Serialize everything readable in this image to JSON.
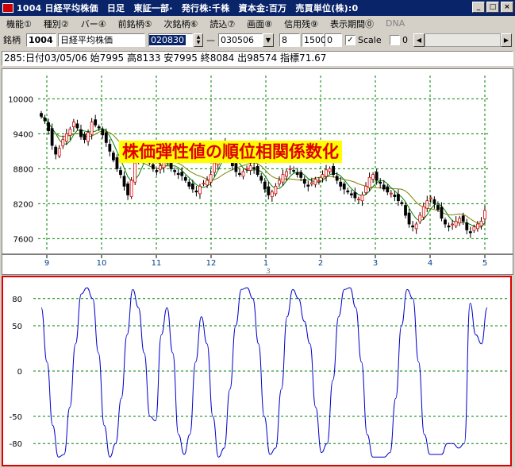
{
  "window": {
    "title": "1004 日経平均株価　日足　東証一部·　発行株:千株　資本金:百万　売買単位(株):0",
    "minimize_glyph": "_",
    "maximize_glyph": "□",
    "close_glyph": "×"
  },
  "menu": [
    "機能①",
    "種別②",
    "バー④",
    "前銘柄⑤",
    "次銘柄⑥",
    "読込⑦",
    "画面⑧",
    "信用残⑨",
    "表示期間⓪"
  ],
  "menu_disabled": "DNA",
  "toolbar": {
    "code_label": "銘柄",
    "code": "1004",
    "name": "日経平均株価",
    "start_date": "020830",
    "dash": "—",
    "end_date": "030506",
    "param1": "8",
    "param2": "1500",
    "param3": "0",
    "scale_checked": "✓",
    "scale_label": "Scale",
    "param4": "0"
  },
  "info": "285:日付03/05/06 始7995 高8133 安7995 終8084 出98574 指標71.67",
  "colors": {
    "up_candle": "#ffffff",
    "down_candle": "#000000",
    "candle_up_outline": "#e00000",
    "ma_short": "#008000",
    "ma_long": "#808000",
    "indicator_line": "#0000cc",
    "grid": "#008000",
    "panel_border": "#e00000",
    "annotation_bg": "#ffff00",
    "annotation_text": "#e00000"
  },
  "annotation": "株価弾性値の順位相関係数化",
  "chart_data": [
    {
      "type": "candlestick",
      "y_ticks": [
        10000,
        9400,
        8800,
        8200,
        7600
      ],
      "ylim": [
        7400,
        10400
      ],
      "x_ticks": [
        "9",
        "10",
        "11",
        "12",
        "1",
        "2",
        "3",
        "4",
        "5"
      ],
      "x_sub_label": "3",
      "grid": true,
      "series": [
        {
          "name": "close",
          "values": [
            9700,
            9620,
            9450,
            9200,
            9050,
            9150,
            9300,
            9400,
            9480,
            9600,
            9500,
            9350,
            9300,
            9420,
            9600,
            9550,
            9500,
            9380,
            9250,
            9100,
            8950,
            8800,
            8700,
            8500,
            8350,
            8600,
            8900,
            9100,
            9200,
            9050,
            8900,
            8800,
            8750,
            8850,
            8950,
            8900,
            8800,
            8750,
            8700,
            8680,
            8600,
            8500,
            8450,
            8400,
            8500,
            8550,
            8600,
            8700,
            8900,
            9100,
            9200,
            9150,
            9000,
            8850,
            8750,
            8700,
            8750,
            8800,
            8850,
            8800,
            8700,
            8600,
            8450,
            8350,
            8400,
            8500,
            8600,
            8700,
            8750,
            8800,
            8760,
            8700,
            8650,
            8550,
            8500,
            8560,
            8620,
            8600,
            8700,
            8780,
            8800,
            8700,
            8600,
            8500,
            8450,
            8400,
            8350,
            8300,
            8280,
            8350,
            8500,
            8650,
            8700,
            8600,
            8550,
            8450,
            8400,
            8380,
            8320,
            8250,
            8200,
            8000,
            7850,
            7800,
            7850,
            8000,
            8150,
            8250,
            8300,
            8200,
            8100,
            7950,
            7850,
            7800,
            7850,
            7900,
            7950,
            7900,
            7750,
            7700,
            7800,
            7850,
            7900,
            8084
          ]
        }
      ]
    },
    {
      "type": "line",
      "y_ticks": [
        80,
        50,
        0,
        -50,
        -80
      ],
      "ylim": [
        -100,
        100
      ],
      "grid": true,
      "series": [
        {
          "name": "",
          "values": [
            70,
            10,
            -60,
            -95,
            -92,
            -40,
            30,
            85,
            92,
            80,
            20,
            -60,
            -95,
            -80,
            -30,
            40,
            90,
            70,
            20,
            -50,
            -55,
            40,
            70,
            20,
            -70,
            -92,
            -70,
            10,
            60,
            30,
            -50,
            -95,
            -85,
            -20,
            50,
            90,
            92,
            80,
            30,
            -50,
            -92,
            -85,
            -20,
            60,
            90,
            80,
            55,
            30,
            -40,
            -90,
            -80,
            -10,
            60,
            90,
            92,
            70,
            10,
            -70,
            -95,
            -95,
            -95,
            -90,
            -30,
            50,
            90,
            80,
            10,
            -70,
            -92,
            -92,
            -92,
            -80,
            -80,
            -85,
            -80,
            75,
            40,
            30,
            70
          ]
        }
      ]
    }
  ]
}
